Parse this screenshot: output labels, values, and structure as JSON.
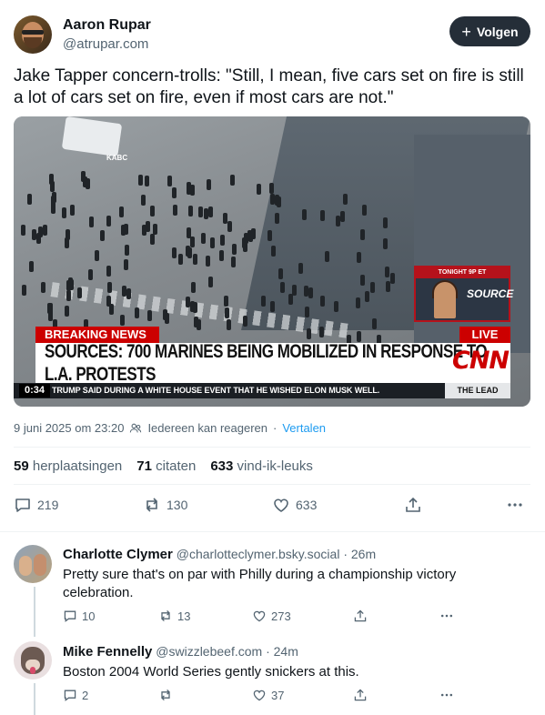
{
  "post": {
    "author_name": "Aaron Rupar",
    "author_handle": "@atrupar.com",
    "follow_label": "Volgen",
    "text": "Jake Tapper concern-trolls: \"Still, I mean, five cars set on fire is still a lot of cars set on fire, even if most cars are not.\"",
    "media": {
      "watermark": "KABC",
      "promo_top": "TONIGHT 9P ET",
      "promo_show": "SOURCE",
      "breaking": "BREAKING NEWS",
      "live": "LIVE",
      "headline": "SOURCES: 700 MARINES BEING MOBILIZED IN RESPONSE TO L.A. PROTESTS",
      "network": "CNN",
      "time": "0:34",
      "ticker": "TRUMP SAID DURING A WHITE HOUSE EVENT THAT HE WISHED ELON MUSK WELL.",
      "show": "THE LEAD"
    },
    "date": "9 juni 2025 om 23:20",
    "reply_setting": "Iedereen kan reageren",
    "dot": "·",
    "translate": "Vertalen",
    "stats": {
      "reposts_count": "59",
      "reposts_label": "herplaatsingen",
      "quotes_count": "71",
      "quotes_label": "citaten",
      "likes_count": "633",
      "likes_label": "vind-ik-leuks"
    },
    "actions": {
      "replies": "219",
      "reposts": "130",
      "likes": "633"
    }
  },
  "replies": [
    {
      "name": "Charlotte Clymer",
      "handle": "@charlotteclymer.bsky.social",
      "time": "· 26m",
      "text": "Pretty sure that's on par with Philly during a championship victory celebration.",
      "replies": "10",
      "reposts": "13",
      "likes": "273"
    },
    {
      "name": "Mike Fennelly",
      "handle": "@swizzlebeef.com",
      "time": "· 24m",
      "text": "Boston 2004 World Series gently snickers at this.",
      "replies": "2",
      "reposts": "",
      "likes": "37"
    }
  ],
  "icons": {
    "reply": "speech-bubble-icon",
    "repost": "repost-arrows-icon",
    "like": "heart-icon",
    "share": "share-upload-icon",
    "more": "more-dots-icon",
    "audience": "people-icon"
  },
  "colors": {
    "accent": "#1d9bf0",
    "follow_bg": "#252e38",
    "muted": "#536471",
    "cnn_red": "#cc0000"
  }
}
